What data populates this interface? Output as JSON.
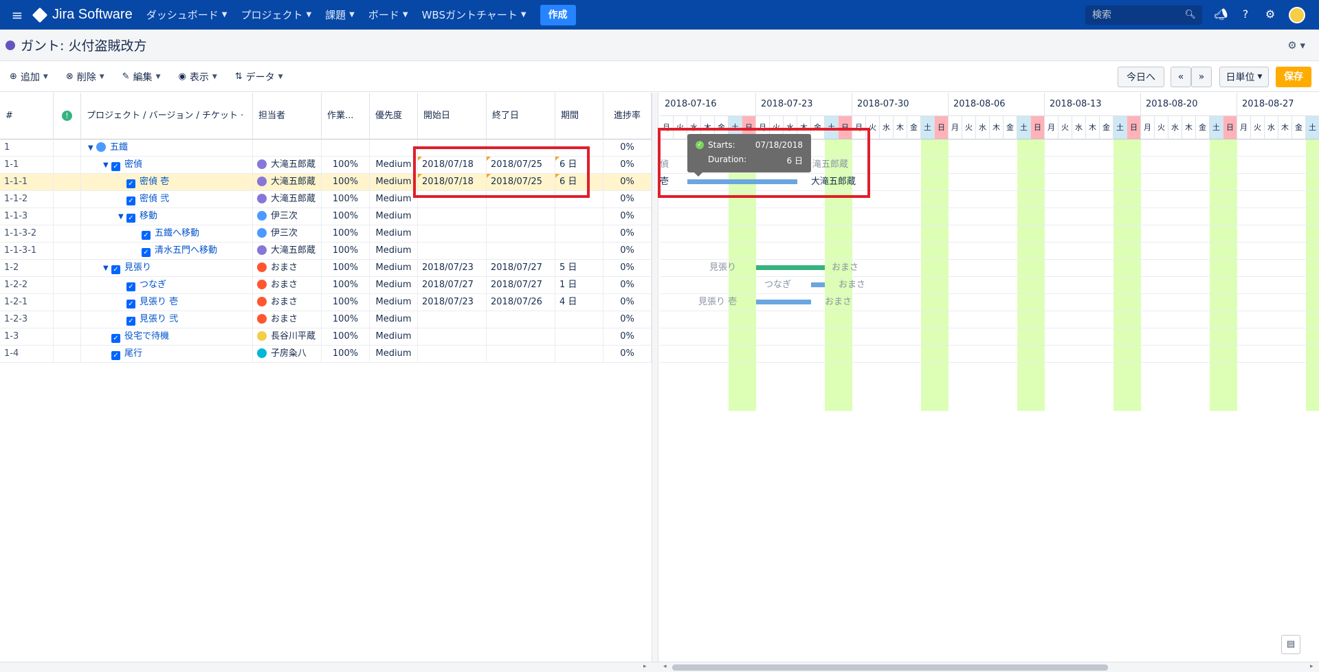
{
  "topnav": {
    "product": "Jira Software",
    "menu": [
      "ダッシュボード",
      "プロジェクト",
      "課題",
      "ボード",
      "WBSガントチャート"
    ],
    "create": "作成",
    "search_placeholder": "検索"
  },
  "page": {
    "title": "ガント: 火付盗賊改方"
  },
  "toolbar": {
    "add": "追加",
    "delete": "削除",
    "edit": "編集",
    "view": "表示",
    "data": "データ",
    "today": "今日へ",
    "prev": "«",
    "next": "»",
    "scale": "日単位",
    "save": "保存"
  },
  "grid": {
    "headers": {
      "num": "#",
      "name": "プロジェクト / バージョン / チケット ·",
      "assignee": "担当者",
      "work": "作業...",
      "priority": "優先度",
      "start": "開始日",
      "end": "終了日",
      "duration": "期間",
      "progress": "進捗率"
    },
    "rows": [
      {
        "num": "1",
        "name": "五鐵",
        "assignee": "",
        "work": "",
        "priority": "",
        "start": "",
        "end": "",
        "duration": "",
        "progress": "0%"
      },
      {
        "num": "1-1",
        "name": "密偵",
        "assignee": "大滝五郎蔵",
        "work": "100%",
        "priority": "Medium",
        "start": "2018/07/18",
        "end": "2018/07/25",
        "duration": "6 日",
        "progress": "0%"
      },
      {
        "num": "1-1-1",
        "name": "密偵 壱",
        "assignee": "大滝五郎蔵",
        "work": "100%",
        "priority": "Medium",
        "start": "2018/07/18",
        "end": "2018/07/25",
        "duration": "6 日",
        "progress": "0%"
      },
      {
        "num": "1-1-2",
        "name": "密偵 弐",
        "assignee": "大滝五郎蔵",
        "work": "100%",
        "priority": "Medium",
        "start": "",
        "end": "",
        "duration": "",
        "progress": "0%"
      },
      {
        "num": "1-1-3",
        "name": "移動",
        "assignee": "伊三次",
        "work": "100%",
        "priority": "Medium",
        "start": "",
        "end": "",
        "duration": "",
        "progress": "0%"
      },
      {
        "num": "1-1-3-2",
        "name": "五鐵へ移動",
        "assignee": "伊三次",
        "work": "100%",
        "priority": "Medium",
        "start": "",
        "end": "",
        "duration": "",
        "progress": "0%"
      },
      {
        "num": "1-1-3-1",
        "name": "清水五門へ移動",
        "assignee": "大滝五郎蔵",
        "work": "100%",
        "priority": "Medium",
        "start": "",
        "end": "",
        "duration": "",
        "progress": "0%"
      },
      {
        "num": "1-2",
        "name": "見張り",
        "assignee": "おまさ",
        "work": "100%",
        "priority": "Medium",
        "start": "2018/07/23",
        "end": "2018/07/27",
        "duration": "5 日",
        "progress": "0%"
      },
      {
        "num": "1-2-2",
        "name": "つなぎ",
        "assignee": "おまさ",
        "work": "100%",
        "priority": "Medium",
        "start": "2018/07/27",
        "end": "2018/07/27",
        "duration": "1 日",
        "progress": "0%"
      },
      {
        "num": "1-2-1",
        "name": "見張り 壱",
        "assignee": "おまさ",
        "work": "100%",
        "priority": "Medium",
        "start": "2018/07/23",
        "end": "2018/07/26",
        "duration": "4 日",
        "progress": "0%"
      },
      {
        "num": "1-2-3",
        "name": "見張り 弐",
        "assignee": "おまさ",
        "work": "100%",
        "priority": "Medium",
        "start": "",
        "end": "",
        "duration": "",
        "progress": "0%"
      },
      {
        "num": "1-3",
        "name": "役宅で待機",
        "assignee": "長谷川平蔵",
        "work": "100%",
        "priority": "Medium",
        "start": "",
        "end": "",
        "duration": "",
        "progress": "0%"
      },
      {
        "num": "1-4",
        "name": "尾行",
        "assignee": "子房粂八",
        "work": "100%",
        "priority": "Medium",
        "start": "",
        "end": "",
        "duration": "",
        "progress": "0%"
      }
    ]
  },
  "gantt": {
    "weeks": [
      "2018-07-16",
      "2018-07-23",
      "2018-07-30",
      "2018-08-06",
      "2018-08-13",
      "2018-08-20",
      "2018-08-27"
    ],
    "day_names": [
      "月",
      "火",
      "水",
      "木",
      "金",
      "土",
      "日"
    ],
    "labels": {
      "r1_left": "偵",
      "r1_right": "滝五郎蔵",
      "r2_left": "壱",
      "r2_right": "大滝五郎蔵",
      "r7_left": "見張り",
      "r7_right": "おまさ",
      "r8_left": "つなぎ",
      "r8_right": "おまさ",
      "r9_left": "見張り 壱",
      "r9_right": "おまさ"
    },
    "tooltip": {
      "starts_label": "Starts:",
      "starts_value": "07/18/2018",
      "duration_label": "Duration:",
      "duration_value": "6 日"
    }
  },
  "colors": {
    "nav": "#0747a6",
    "weekend_green": "#dcffb5",
    "highlight_red": "#e01e2b",
    "save": "#ffab00"
  }
}
